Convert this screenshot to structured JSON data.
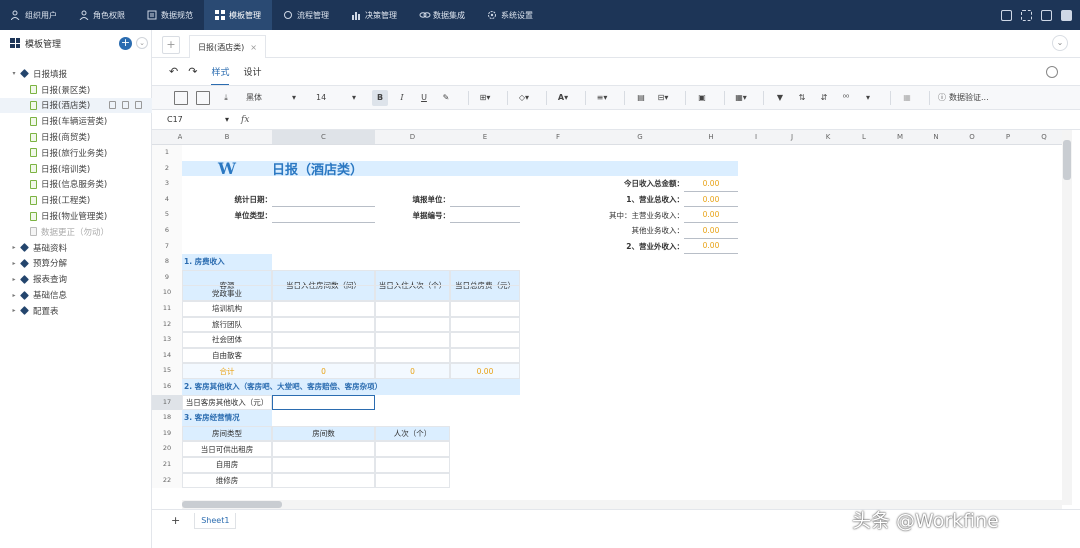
{
  "topnav": {
    "items": [
      {
        "label": "组织用户",
        "icon": "users-icon"
      },
      {
        "label": "角色权限",
        "icon": "user-icon"
      },
      {
        "label": "数据规范",
        "icon": "settings-icon"
      },
      {
        "label": "模板管理",
        "icon": "template-icon"
      },
      {
        "label": "流程管理",
        "icon": "refresh-icon"
      },
      {
        "label": "决策管理",
        "icon": "bar-chart-icon"
      },
      {
        "label": "数据集成",
        "icon": "link-icon"
      },
      {
        "label": "系统设置",
        "icon": "gear-icon"
      }
    ],
    "active_index": 3,
    "bg_color": "#1d3557"
  },
  "sidebar": {
    "title": "模板管理",
    "add_label": "+",
    "collapse_label": "⌄",
    "tree": [
      {
        "label": "日报填报",
        "type": "folder",
        "expanded": true
      },
      {
        "label": "日报(景区类)",
        "type": "doc"
      },
      {
        "label": "日报(酒店类)",
        "type": "doc",
        "selected": true
      },
      {
        "label": "日报(车辆运营类)",
        "type": "doc"
      },
      {
        "label": "日报(商贸类)",
        "type": "doc"
      },
      {
        "label": "日报(旅行业务类)",
        "type": "doc"
      },
      {
        "label": "日报(培训类)",
        "type": "doc"
      },
      {
        "label": "日报(信息服务类)",
        "type": "doc"
      },
      {
        "label": "日报(工程类)",
        "type": "doc"
      },
      {
        "label": "日报(物业管理类)",
        "type": "doc"
      },
      {
        "label": "数据更正（勿动）",
        "type": "doc-disabled"
      },
      {
        "label": "基础资料",
        "type": "folder"
      },
      {
        "label": "预算分解",
        "type": "folder"
      },
      {
        "label": "报表查询",
        "type": "folder"
      },
      {
        "label": "基础信息",
        "type": "folder"
      },
      {
        "label": "配置表",
        "type": "folder"
      }
    ]
  },
  "tabs": {
    "add_label": "+",
    "open_tab": "日报(酒店类)",
    "close_label": "×",
    "collapse_label": "⌄"
  },
  "modebar": {
    "undo": "↶",
    "redo": "↷",
    "modes": [
      "样式",
      "设计"
    ],
    "active_mode": "样式"
  },
  "toolbar": {
    "font_family": "黑体",
    "font_size": "14",
    "bold": "B",
    "italic": "I",
    "underline": "U",
    "text_color": "A",
    "validate_label": "数据验证..."
  },
  "formula_bar": {
    "cell_ref": "C17",
    "fx": "fx",
    "value": ""
  },
  "sheet": {
    "columns": [
      "A",
      "B",
      "C",
      "D",
      "E",
      "F",
      "G",
      "H",
      "I",
      "J",
      "K",
      "L",
      "M",
      "N",
      "O",
      "P",
      "Q"
    ],
    "selected_column": "C",
    "rows": [
      "1",
      "2",
      "3",
      "4",
      "5",
      "6",
      "7",
      "8",
      "9",
      "10",
      "11",
      "12",
      "13",
      "14",
      "15",
      "16",
      "17",
      "18",
      "19",
      "20",
      "21",
      "22"
    ],
    "selected_row": "17",
    "logo": "W",
    "title": "日报（酒店类）",
    "header_fields": {
      "stat_date": "统计日期：",
      "unit_type": "单位类型：",
      "fill_unit": "填报单位：",
      "form_no": "单据编号："
    },
    "income_summary": [
      {
        "label": "今日收入总金额：",
        "value": "0.00"
      },
      {
        "label": "1、营业总收入：",
        "value": "0.00"
      },
      {
        "label": "其中：主营业务收入：",
        "value": "0.00"
      },
      {
        "label": "其他业务收入：",
        "value": "0.00"
      },
      {
        "label": "2、营业外收入：",
        "value": "0.00"
      }
    ],
    "section1": {
      "title": "1. 房费收入",
      "headers": [
        "客源",
        "当日入住房间数（间）",
        "当日入住人次（个）",
        "当日总房费（元）"
      ],
      "sources": [
        "党政事业",
        "培训机构",
        "旅行团队",
        "社会团体",
        "自由散客"
      ],
      "total_label": "合计",
      "totals": [
        "0",
        "0",
        "0.00"
      ]
    },
    "section2": {
      "title": "2. 客房其他收入（客房吧、大堂吧、客房赔偿、客房杂项）",
      "row_label": "当日客房其他收入（元）"
    },
    "section3": {
      "title": "3. 客房经营情况",
      "headers": [
        "房间类型",
        "房间数",
        "人次（个）"
      ],
      "types": [
        "当日可供出租房",
        "自用房",
        "维修房"
      ]
    }
  },
  "sheet_tabs": {
    "add_label": "+",
    "tabs": [
      "Sheet1"
    ]
  },
  "watermark": "头条 @Workfine"
}
